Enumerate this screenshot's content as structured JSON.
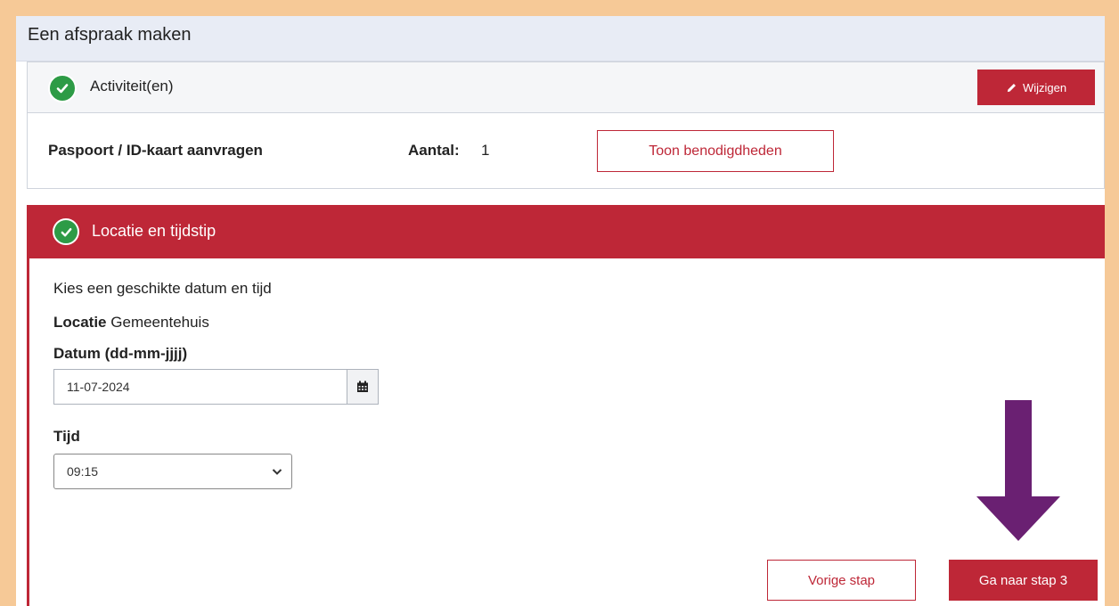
{
  "page": {
    "title": "Een afspraak maken"
  },
  "step1": {
    "title": "Activiteit(en)",
    "edit_label": "Wijzigen",
    "activity": {
      "name": "Paspoort / ID-kaart aanvragen",
      "count_label": "Aantal:",
      "count_value": "1",
      "requirements_label": "Toon benodigdheden"
    }
  },
  "step2": {
    "title": "Locatie en tijdstip",
    "intro": "Kies een geschikte datum en tijd",
    "location_label": "Locatie",
    "location_value": "Gemeentehuis",
    "date_label": "Datum (dd-mm-jjjj)",
    "date_value": "11-07-2024",
    "time_label": "Tijd",
    "time_value": "09:15",
    "prev_label": "Vorige stap",
    "next_label": "Ga naar stap 3"
  },
  "colors": {
    "accent": "#be2737",
    "success": "#2d9b46",
    "border_frame": "#f6c997",
    "annotation_arrow": "#6a2072"
  },
  "icons": [
    "check-icon",
    "pencil-icon",
    "calendar-icon",
    "chevron-down-icon",
    "arrow-down-icon"
  ]
}
